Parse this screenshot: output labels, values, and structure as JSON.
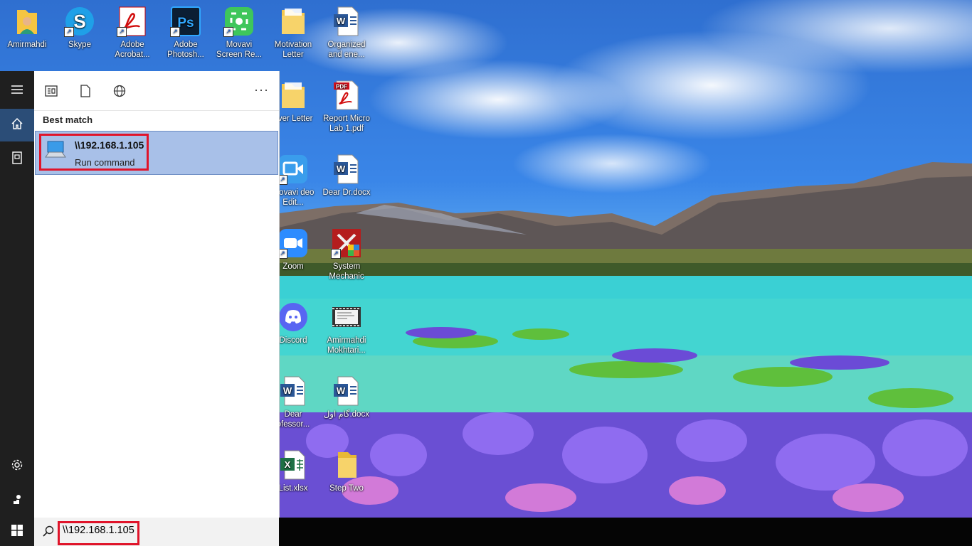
{
  "desktop": {
    "icons": [
      {
        "label": "Amirmahdi",
        "icon": "user-folder-icon"
      },
      {
        "label": "Skype",
        "icon": "skype-icon"
      },
      {
        "label": "Adobe Acrobat...",
        "icon": "acrobat-icon"
      },
      {
        "label": "Adobe Photosh...",
        "icon": "photoshop-icon"
      },
      {
        "label": "Movavi Screen Re...",
        "icon": "movavi-screen-icon"
      },
      {
        "label": "Motivation Letter",
        "icon": "folder-icon"
      },
      {
        "label": "Organized and ene...",
        "icon": "word-doc-icon"
      },
      {
        "label": "over Letter",
        "icon": "folder-icon"
      },
      {
        "label": "Report Micro Lab 1.pdf",
        "icon": "pdf-icon"
      },
      {
        "label": "Movavi deo Edit...",
        "icon": "movavi-video-icon"
      },
      {
        "label": "Dear Dr.docx",
        "icon": "word-doc-icon"
      },
      {
        "label": "Zoom",
        "icon": "zoom-icon"
      },
      {
        "label": "System Mechanic",
        "icon": "system-mechanic-icon"
      },
      {
        "label": "Discord",
        "icon": "discord-icon"
      },
      {
        "label": "Amirmahdi Mokhtari...",
        "icon": "video-file-icon"
      },
      {
        "label": "Dear ofessor...",
        "icon": "word-doc-icon"
      },
      {
        "label": "گام اول.docx",
        "icon": "word-doc-icon"
      },
      {
        "label": "List.xlsx",
        "icon": "excel-icon"
      },
      {
        "label": "Step Two",
        "icon": "folder-icon"
      }
    ]
  },
  "start_menu": {
    "rail": {
      "menu": "hamburger-icon",
      "home": "home-icon",
      "documents": "document-icon",
      "settings": "gear-icon",
      "power_user": "user-icon"
    },
    "filters": [
      "all-apps-icon",
      "documents-icon",
      "web-icon"
    ],
    "more_label": "···",
    "best_match_heading": "Best match",
    "result": {
      "title": "\\\\192.168.1.105",
      "subtitle": "Run command"
    }
  },
  "search": {
    "value": "\\\\192.168.1.105"
  },
  "colors": {
    "highlight_red": "#e0142a",
    "result_bg": "#a8c0e8",
    "rail_bg": "#1f1f1f"
  }
}
